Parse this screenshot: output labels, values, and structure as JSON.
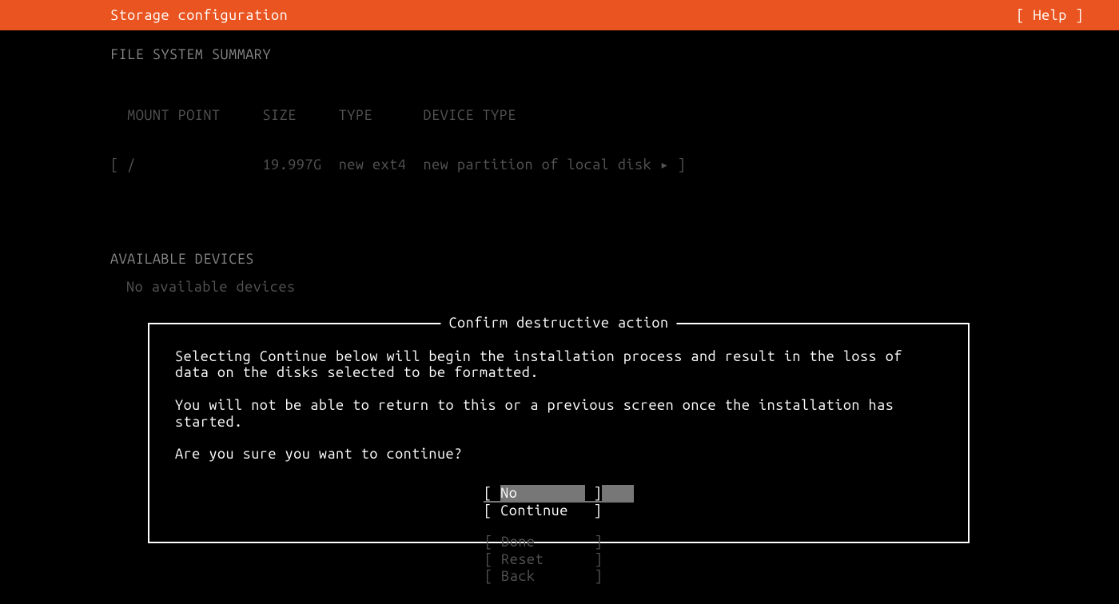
{
  "header": {
    "title": "Storage configuration",
    "help": "[ Help ]"
  },
  "fs_summary": {
    "heading": "FILE SYSTEM SUMMARY",
    "columns_line": "  MOUNT POINT     SIZE     TYPE      DEVICE TYPE",
    "row_open": "[ ",
    "row_mount": "/               ",
    "row_size": "19.997G  ",
    "row_type": "new ext4  ",
    "row_device": "new partition of local disk ",
    "row_arrow": "▸",
    "row_close": " ]"
  },
  "available": {
    "heading": "AVAILABLE DEVICES",
    "body": "No available devices"
  },
  "dialog": {
    "title": "Confirm destructive action",
    "para1": "Selecting Continue below will begin the installation process and result in the loss of data on the disks selected to be formatted.",
    "para2": "You will not be able to return to this or a previous screen once the installation has started.",
    "para3": "Are you sure you want to continue?",
    "buttons": {
      "no": "No        ",
      "continue": "Continue  "
    }
  },
  "footer": {
    "done": "Done      ",
    "reset": "Reset     ",
    "back": "Back      "
  },
  "brackets": {
    "l": "[ ",
    "r": " ]"
  }
}
